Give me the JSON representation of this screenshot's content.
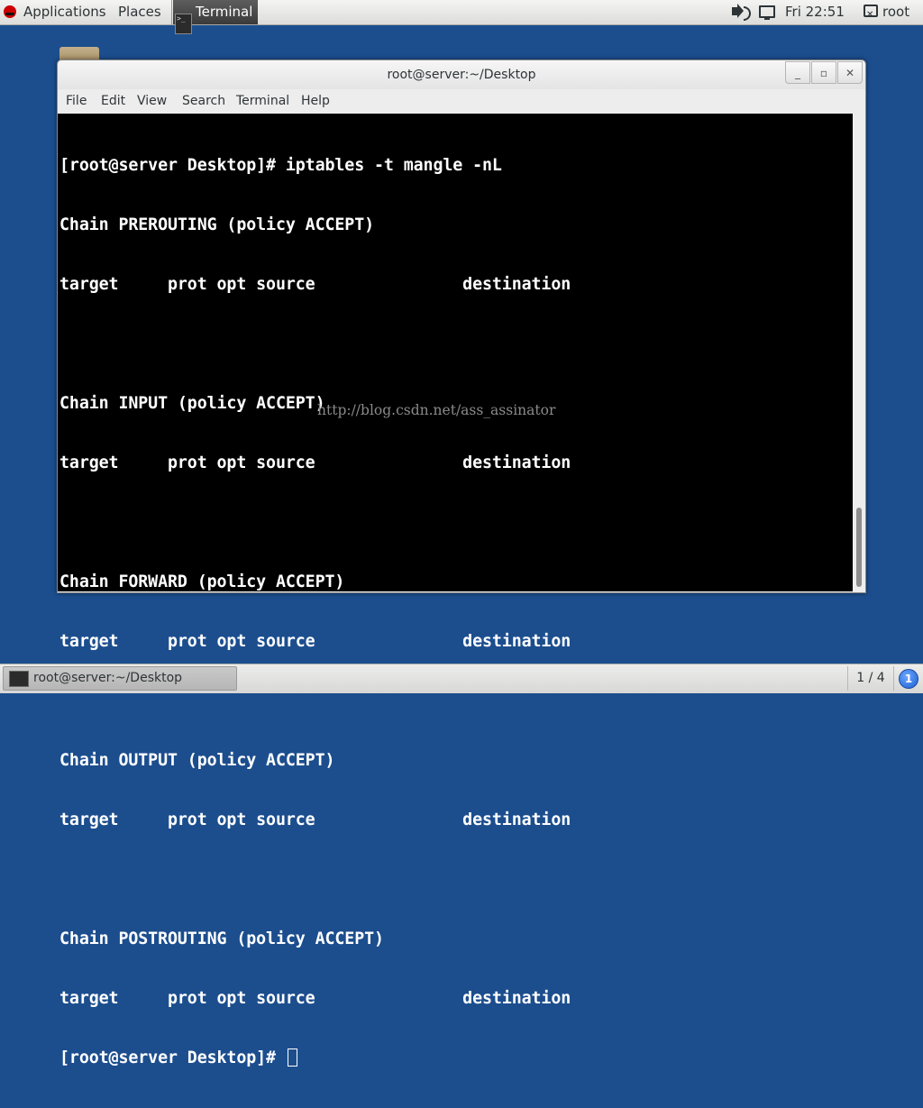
{
  "top_panel": {
    "applications_label": "Applications",
    "places_label": "Places",
    "active_app_label": "Terminal",
    "clock": "Fri 22:51",
    "user": "root"
  },
  "window": {
    "title": "root@server:~/Desktop",
    "menu": [
      "File",
      "Edit",
      "View",
      "Search",
      "Terminal",
      "Help"
    ]
  },
  "terminal": {
    "lines": [
      "[root@server Desktop]# iptables -t mangle -nL",
      "Chain PREROUTING (policy ACCEPT)",
      "target     prot opt source               destination",
      "",
      "Chain INPUT (policy ACCEPT)",
      "target     prot opt source               destination",
      "",
      "Chain FORWARD (policy ACCEPT)",
      "target     prot opt source               destination",
      "",
      "Chain OUTPUT (policy ACCEPT)",
      "target     prot opt source               destination",
      "",
      "Chain POSTROUTING (policy ACCEPT)",
      "target     prot opt source               destination"
    ],
    "prompt": "[root@server Desktop]# ",
    "watermark": "http://blog.csdn.net/ass_assinator"
  },
  "bottom_panel": {
    "task_label": "root@server:~/Desktop",
    "workspace": "1 / 4",
    "notification_count": "1"
  },
  "colors": {
    "desktop": "#1c4e8e",
    "terminal_bg": "#000000",
    "terminal_fg": "#ffffff"
  },
  "icons": [
    "redhat-icon",
    "terminal-icon",
    "volume-icon",
    "network-icon",
    "user-icon",
    "folder-icon"
  ]
}
